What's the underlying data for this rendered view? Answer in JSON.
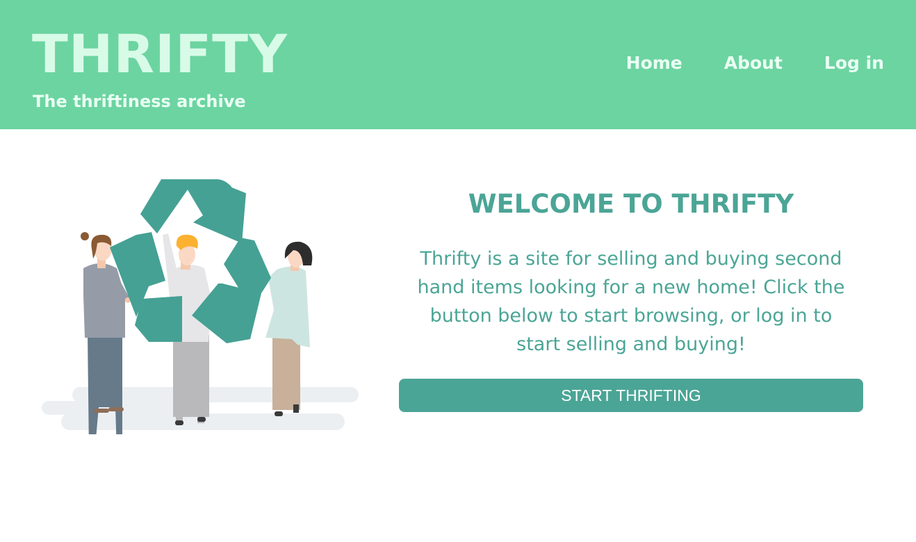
{
  "header": {
    "title": "THRIFTY",
    "tagline": "The thriftiness archive",
    "nav": {
      "home": "Home",
      "about": "About",
      "login": "Log in"
    }
  },
  "hero": {
    "illustration": "people-holding-recycle-symbol-illustration",
    "heading": "WELCOME TO THRIFTY",
    "description": "Thrifty is a site for selling and buying second hand items looking for a new home! Click the button below to start browsing, or log in to start selling and buying!",
    "cta_label": "START THRIFTING"
  },
  "colors": {
    "header_bg": "#6cd4a1",
    "accent": "#4ba596",
    "header_text": "#eafff3"
  }
}
